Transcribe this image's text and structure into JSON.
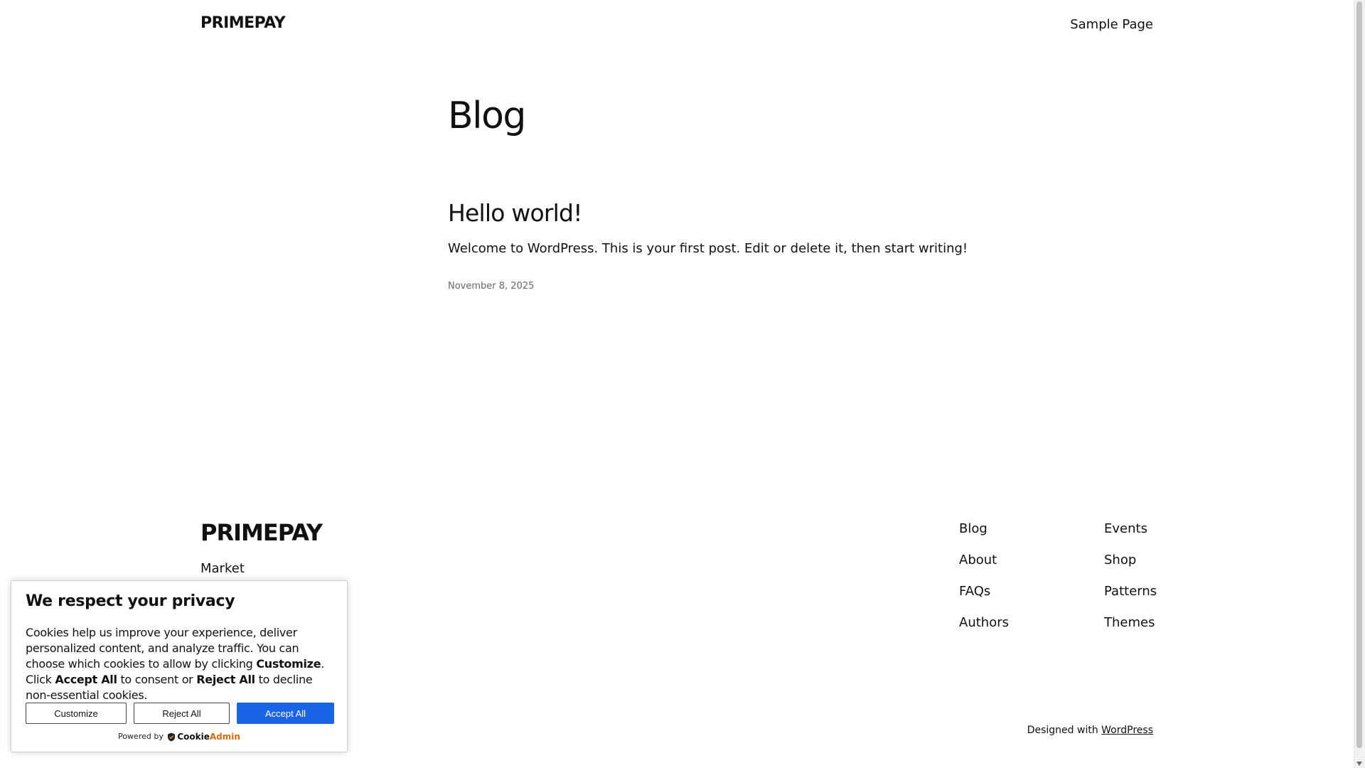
{
  "header": {
    "site_title": "PRIMEPAY",
    "nav": [
      {
        "label": "Sample Page"
      }
    ]
  },
  "main": {
    "page_title": "Blog",
    "posts": [
      {
        "title": "Hello world!",
        "excerpt": "Welcome to WordPress. This is your first post. Edit or delete it, then start writing!",
        "date": "November 8, 2025"
      }
    ]
  },
  "footer": {
    "brand": "PRIMEPAY",
    "tagline": "Market",
    "links_col1": [
      "Blog",
      "About",
      "FAQs",
      "Authors"
    ],
    "links_col2": [
      "Events",
      "Shop",
      "Patterns",
      "Themes"
    ],
    "credits_prefix": "Designed with ",
    "credits_link": "WordPress"
  },
  "cookie_banner": {
    "heading": "We respect your privacy",
    "text_part1": "Cookies help us improve your experience, deliver personalized content, and analyze traffic. You can choose which cookies to allow by clicking ",
    "text_bold1": "Customize",
    "text_part2": ". Click ",
    "text_bold2": "Accept All",
    "text_part3": " to consent or ",
    "text_bold3": "Reject All",
    "text_part4": " to decline non-essential cookies.",
    "buttons": {
      "customize": "Customize",
      "reject": "Reject All",
      "accept": "Accept All"
    },
    "powered_by": "Powered by",
    "brand_cookie": "Cookie",
    "brand_admin": "Admin",
    "colors": {
      "accept_bg": "#1a64e6",
      "brand_admin": "#d36b12"
    }
  }
}
